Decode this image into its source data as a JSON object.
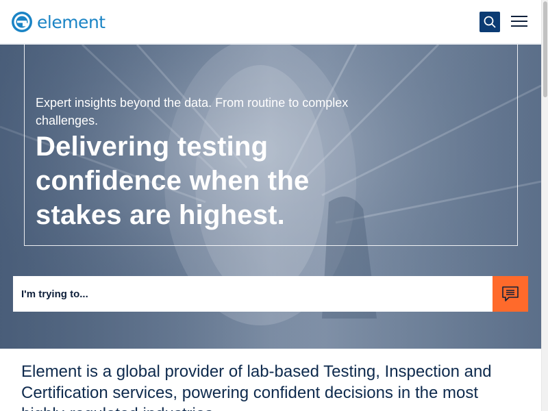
{
  "header": {
    "logo_text": "element",
    "search_icon": "search-icon",
    "menu_icon": "hamburger-menu-icon"
  },
  "hero": {
    "subtitle": "Expert insights beyond the data. From routine to complex challenges.",
    "title": "Delivering testing confidence when the stakes are highest.",
    "search_placeholder": "I'm trying to...",
    "chat_icon": "chat-icon"
  },
  "intro": {
    "text": "Element is a global provider of lab-based Testing, Inspection and Certification services, powering confident decisions in the most highly-regulated industries."
  },
  "colors": {
    "brand_blue": "#1b84c5",
    "navy": "#0b3b73",
    "accent_orange": "#ff6a2b",
    "text_dark": "#0e2a4d"
  }
}
